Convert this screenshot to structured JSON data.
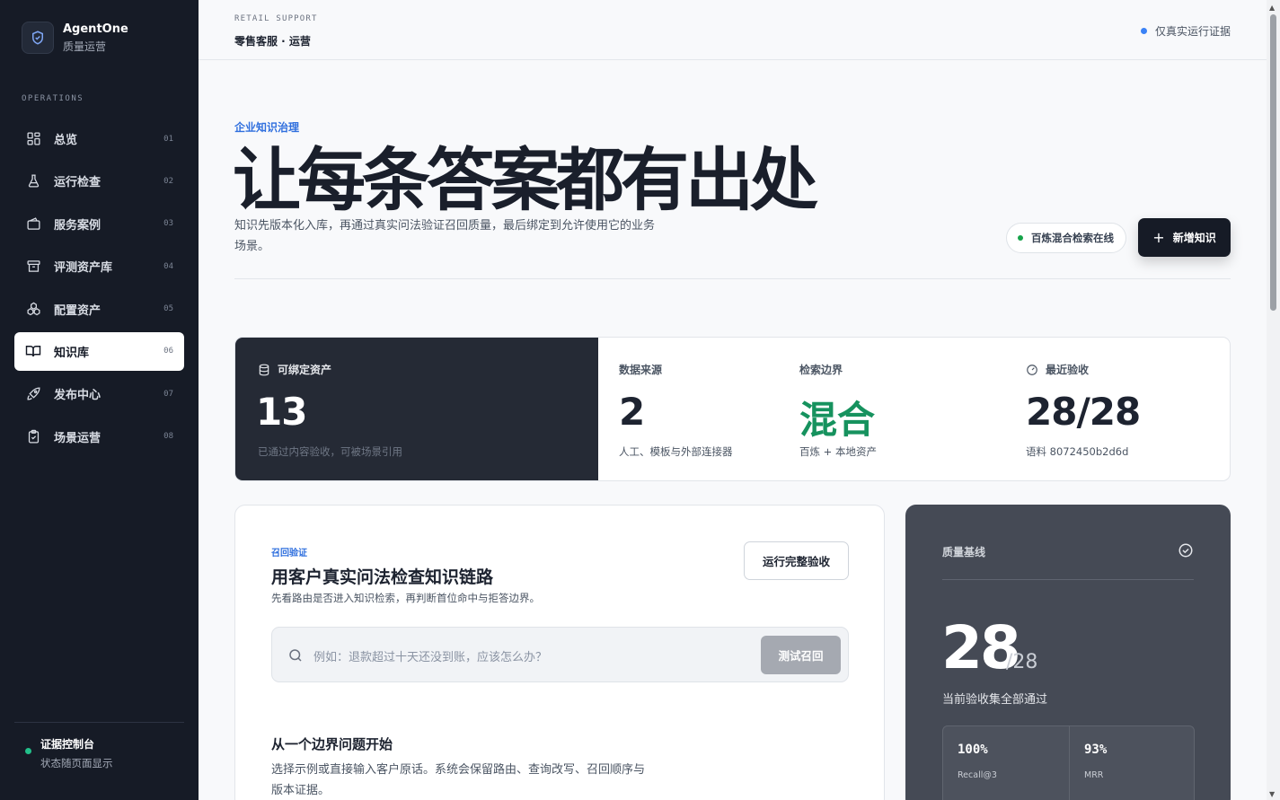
{
  "brand": {
    "name": "AgentOne",
    "subtitle": "质量运营"
  },
  "sidebar": {
    "section_label": "OPERATIONS",
    "items": [
      {
        "label": "总览",
        "num": "01",
        "icon": "grid-icon"
      },
      {
        "label": "运行检查",
        "num": "02",
        "icon": "flask-icon"
      },
      {
        "label": "服务案例",
        "num": "03",
        "icon": "wallet-icon"
      },
      {
        "label": "评测资产库",
        "num": "04",
        "icon": "archive-icon"
      },
      {
        "label": "配置资产",
        "num": "05",
        "icon": "cubes-icon"
      },
      {
        "label": "知识库",
        "num": "06",
        "icon": "book-icon",
        "active": true
      },
      {
        "label": "发布中心",
        "num": "07",
        "icon": "rocket-icon"
      },
      {
        "label": "场景运营",
        "num": "08",
        "icon": "clipboard-check-icon"
      }
    ],
    "footer": {
      "title": "证据控制台",
      "subtitle": "状态随页面显示"
    }
  },
  "topbar": {
    "kicker": "RETAIL SUPPORT",
    "title": "零售客服 · 运营",
    "status": "仅真实运行证据"
  },
  "hero": {
    "kicker": "企业知识治理",
    "title": "让每条答案都有出处",
    "description": "知识先版本化入库，再通过真实问法验证召回质量，最后绑定到允许使用它的业务场景。",
    "pill": "百炼混合检索在线",
    "primary_button": "新增知识"
  },
  "stats": {
    "bindable": {
      "label": "可绑定资产",
      "value": "13",
      "sub": "已通过内容验收，可被场景引用"
    },
    "sources": {
      "label": "数据来源",
      "value": "2",
      "sub": "人工、模板与外部连接器"
    },
    "boundary": {
      "label": "检索边界",
      "value": "混合",
      "sub": "百炼 + 本地资产"
    },
    "recent": {
      "label": "最近验收",
      "value": "28/28",
      "sub": "语料 8072450b2d6d"
    }
  },
  "recall": {
    "kicker": "召回验证",
    "title": "用客户真实问法检查知识链路",
    "subtitle": "先看路由是否进入知识检索，再判断首位命中与拒答边界。",
    "run_button": "运行完整验收",
    "search_placeholder": "例如：退款超过十天还没到账，应该怎么办？",
    "search_button": "测试召回",
    "empty_title": "从一个边界问题开始",
    "empty_desc": "选择示例或直接输入客户原话。系统会保留路由、查询改写、召回顺序与版本证据。"
  },
  "quality": {
    "title": "质量基线",
    "big": "28",
    "denominator": "/28",
    "summary": "当前验收集全部通过",
    "metrics": [
      {
        "value": "100%",
        "label": "Recall@3"
      },
      {
        "value": "93%",
        "label": "MRR"
      }
    ]
  },
  "colors": {
    "sidebar_bg": "#161b26",
    "accent_blue": "#2f6fde",
    "accent_green": "#16925e",
    "dark_panel": "#252a35",
    "quality_panel": "#454a55"
  }
}
